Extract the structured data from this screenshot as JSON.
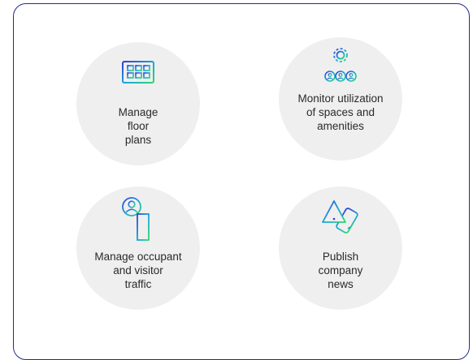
{
  "features": [
    {
      "label": "Manage\nfloor\nplans",
      "icon": "floor-plan-monitor-icon"
    },
    {
      "label": "Monitor utilization\nof spaces and\namenities",
      "icon": "gear-network-icon"
    },
    {
      "label": "Manage occupant\nand visitor\ntraffic",
      "icon": "person-building-icon"
    },
    {
      "label": "Publish\ncompany\nnews",
      "icon": "alert-phone-icon"
    }
  ],
  "colors": {
    "border": "#1f2c8f",
    "circle": "#efefef",
    "gradient_start": "#2f3fd6",
    "gradient_mid": "#1aa9d9",
    "gradient_end": "#2fd66b"
  }
}
